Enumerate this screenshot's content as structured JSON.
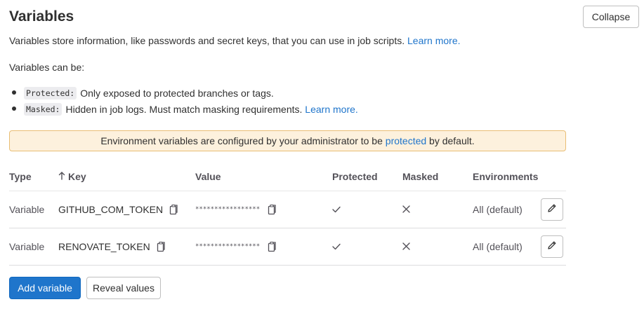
{
  "header": {
    "title": "Variables",
    "collapse_label": "Collapse"
  },
  "intro": {
    "text": "Variables store information, like passwords and secret keys, that you can use in job scripts. ",
    "link": "Learn more."
  },
  "can_be": "Variables can be:",
  "bullets": [
    {
      "code": "Protected:",
      "text": "Only exposed to protected branches or tags.",
      "link": ""
    },
    {
      "code": "Masked:",
      "text": "Hidden in job logs. Must match masking requirements. ",
      "link": "Learn more."
    }
  ],
  "alert": {
    "before": "Environment variables are configured by your administrator to be ",
    "link": "protected",
    "after": " by default."
  },
  "table": {
    "headers": {
      "type": "Type",
      "key": "Key",
      "value": "Value",
      "protected": "Protected",
      "masked": "Masked",
      "environments": "Environments"
    },
    "rows": [
      {
        "type": "Variable",
        "key": "GITHUB_COM_TOKEN",
        "value": "*****************",
        "protected": "✓",
        "masked": "✕",
        "environment": "All (default)"
      },
      {
        "type": "Variable",
        "key": "RENOVATE_TOKEN",
        "value": "*****************",
        "protected": "✓",
        "masked": "✕",
        "environment": "All (default)"
      }
    ]
  },
  "footer": {
    "add_label": "Add variable",
    "reveal_label": "Reveal values"
  },
  "colors": {
    "link": "#1f75cb",
    "alert_bg": "#fdf1dd",
    "alert_border": "#e9be74",
    "primary": "#1f75cb"
  },
  "icons": {
    "copy": "copy-icon",
    "edit": "pencil-icon",
    "check": "check-icon",
    "close": "close-icon",
    "sort": "arrow-up-icon"
  }
}
